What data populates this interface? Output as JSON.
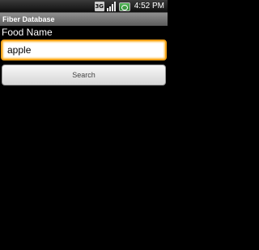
{
  "status_bar": {
    "network_type": "3G",
    "time": "4:52 PM",
    "icons": [
      "3g-icon",
      "signal-strength-icon",
      "battery-icon"
    ]
  },
  "title_bar": {
    "title": "Fiber Database"
  },
  "form": {
    "label": "Food Name",
    "input_value": "apple",
    "search_button_label": "Search"
  },
  "colors": {
    "background": "#000000",
    "input_focus_border": "#f3a21a",
    "title_bar": "#7a7a7a"
  }
}
